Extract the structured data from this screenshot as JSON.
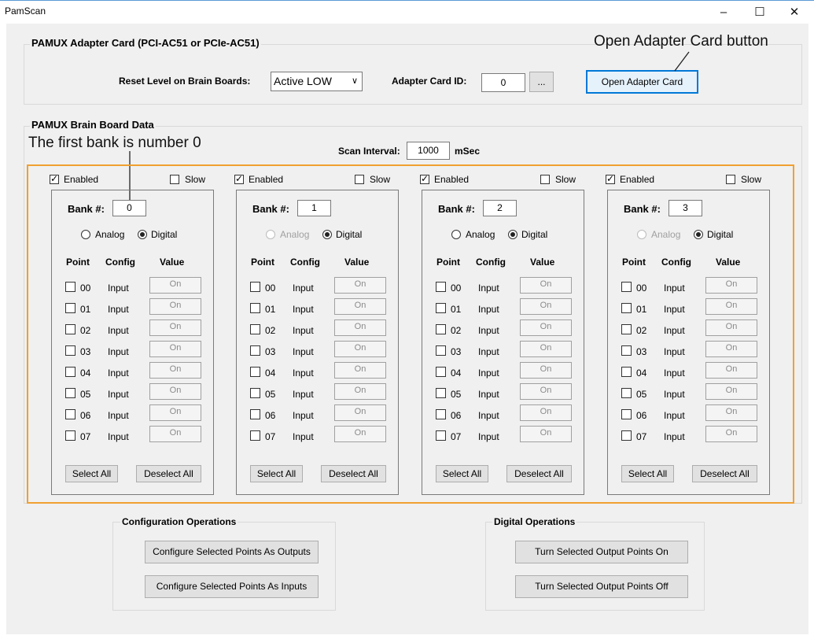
{
  "window": {
    "title": "PamScan",
    "minimize": "–",
    "maximize": "☐",
    "close": "✕"
  },
  "adapter": {
    "group_label": "PAMUX Adapter Card (PCI-AC51 or PCIe-AC51)",
    "reset_label": "Reset Level on Brain Boards:",
    "reset_value": "Active LOW",
    "card_id_label": "Adapter Card ID:",
    "card_id_value": "0",
    "browse_label": "...",
    "open_button": "Open Adapter Card"
  },
  "brain": {
    "group_label": "PAMUX Brain Board Data",
    "scan_label": "Scan Interval:",
    "scan_value": "1000",
    "scan_unit": "mSec",
    "banks": [
      {
        "enabled": true,
        "slow": false,
        "number": "0",
        "analog_enabled": true,
        "mode": "Digital"
      },
      {
        "enabled": true,
        "slow": false,
        "number": "1",
        "analog_enabled": false,
        "mode": "Digital"
      },
      {
        "enabled": true,
        "slow": false,
        "number": "2",
        "analog_enabled": true,
        "mode": "Digital"
      },
      {
        "enabled": true,
        "slow": false,
        "number": "3",
        "analog_enabled": false,
        "mode": "Digital"
      }
    ],
    "enabled_label": "Enabled",
    "slow_label": "Slow",
    "bank_label": "Bank #:",
    "analog_label": "Analog",
    "digital_label": "Digital",
    "headers": {
      "point": "Point",
      "config": "Config",
      "value": "Value"
    },
    "points": [
      "00",
      "01",
      "02",
      "03",
      "04",
      "05",
      "06",
      "07"
    ],
    "config_value": "Input",
    "value_text": "On",
    "select_all": "Select All",
    "deselect_all": "Deselect All"
  },
  "config_ops": {
    "group_label": "Configuration Operations",
    "outputs_button": "Configure Selected Points As Outputs",
    "inputs_button": "Configure Selected Points As Inputs"
  },
  "digital_ops": {
    "group_label": "Digital Operations",
    "on_button": "Turn Selected Output Points On",
    "off_button": "Turn Selected Output Points Off"
  },
  "annotations": {
    "open_button_callout": "Open Adapter Card button",
    "bank_callout": "The first bank is number 0"
  },
  "colors": {
    "highlight": "#f0a030",
    "focus": "#0078d7",
    "background": "#f0f0f0"
  }
}
